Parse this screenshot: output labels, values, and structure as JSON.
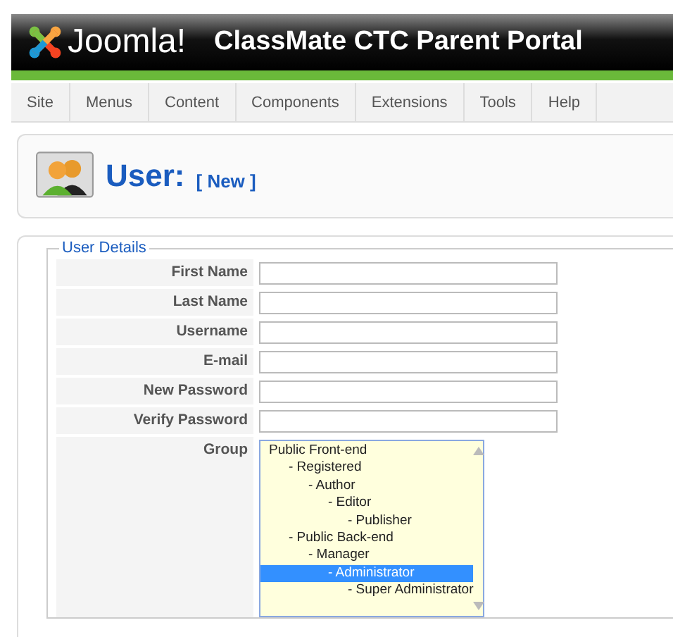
{
  "header": {
    "logo_text": "Joomla!",
    "title": "ClassMate CTC Parent Portal"
  },
  "menu": [
    {
      "label": "Site"
    },
    {
      "label": "Menus"
    },
    {
      "label": "Content"
    },
    {
      "label": "Components"
    },
    {
      "label": "Extensions"
    },
    {
      "label": "Tools"
    },
    {
      "label": "Help"
    }
  ],
  "toolbar": {
    "title": "User:",
    "subtitle": "[ New ]"
  },
  "form": {
    "legend": "User Details",
    "fields": [
      {
        "label": "First Name"
      },
      {
        "label": "Last Name"
      },
      {
        "label": "Username"
      },
      {
        "label": "E-mail"
      },
      {
        "label": "New Password"
      },
      {
        "label": "Verify Password"
      }
    ],
    "group": {
      "label": "Group",
      "options": [
        {
          "label": "Public Front-end",
          "selected": false,
          "children": [
            {
              "label": "- Registered",
              "selected": false,
              "children": [
                {
                  "label": "- Author",
                  "selected": false,
                  "children": [
                    {
                      "label": "- Editor",
                      "selected": false,
                      "children": [
                        {
                          "label": "- Publisher",
                          "selected": false
                        }
                      ]
                    }
                  ]
                }
              ]
            },
            {
              "label": "-  Public Back-end",
              "selected": false,
              "children": [
                {
                  "label": "- Manager",
                  "selected": false,
                  "children": [
                    {
                      "label": "- Administrator",
                      "selected": true,
                      "children": [
                        {
                          "label": "- Super Administrator",
                          "selected": false
                        }
                      ]
                    }
                  ]
                }
              ]
            }
          ]
        }
      ]
    }
  }
}
